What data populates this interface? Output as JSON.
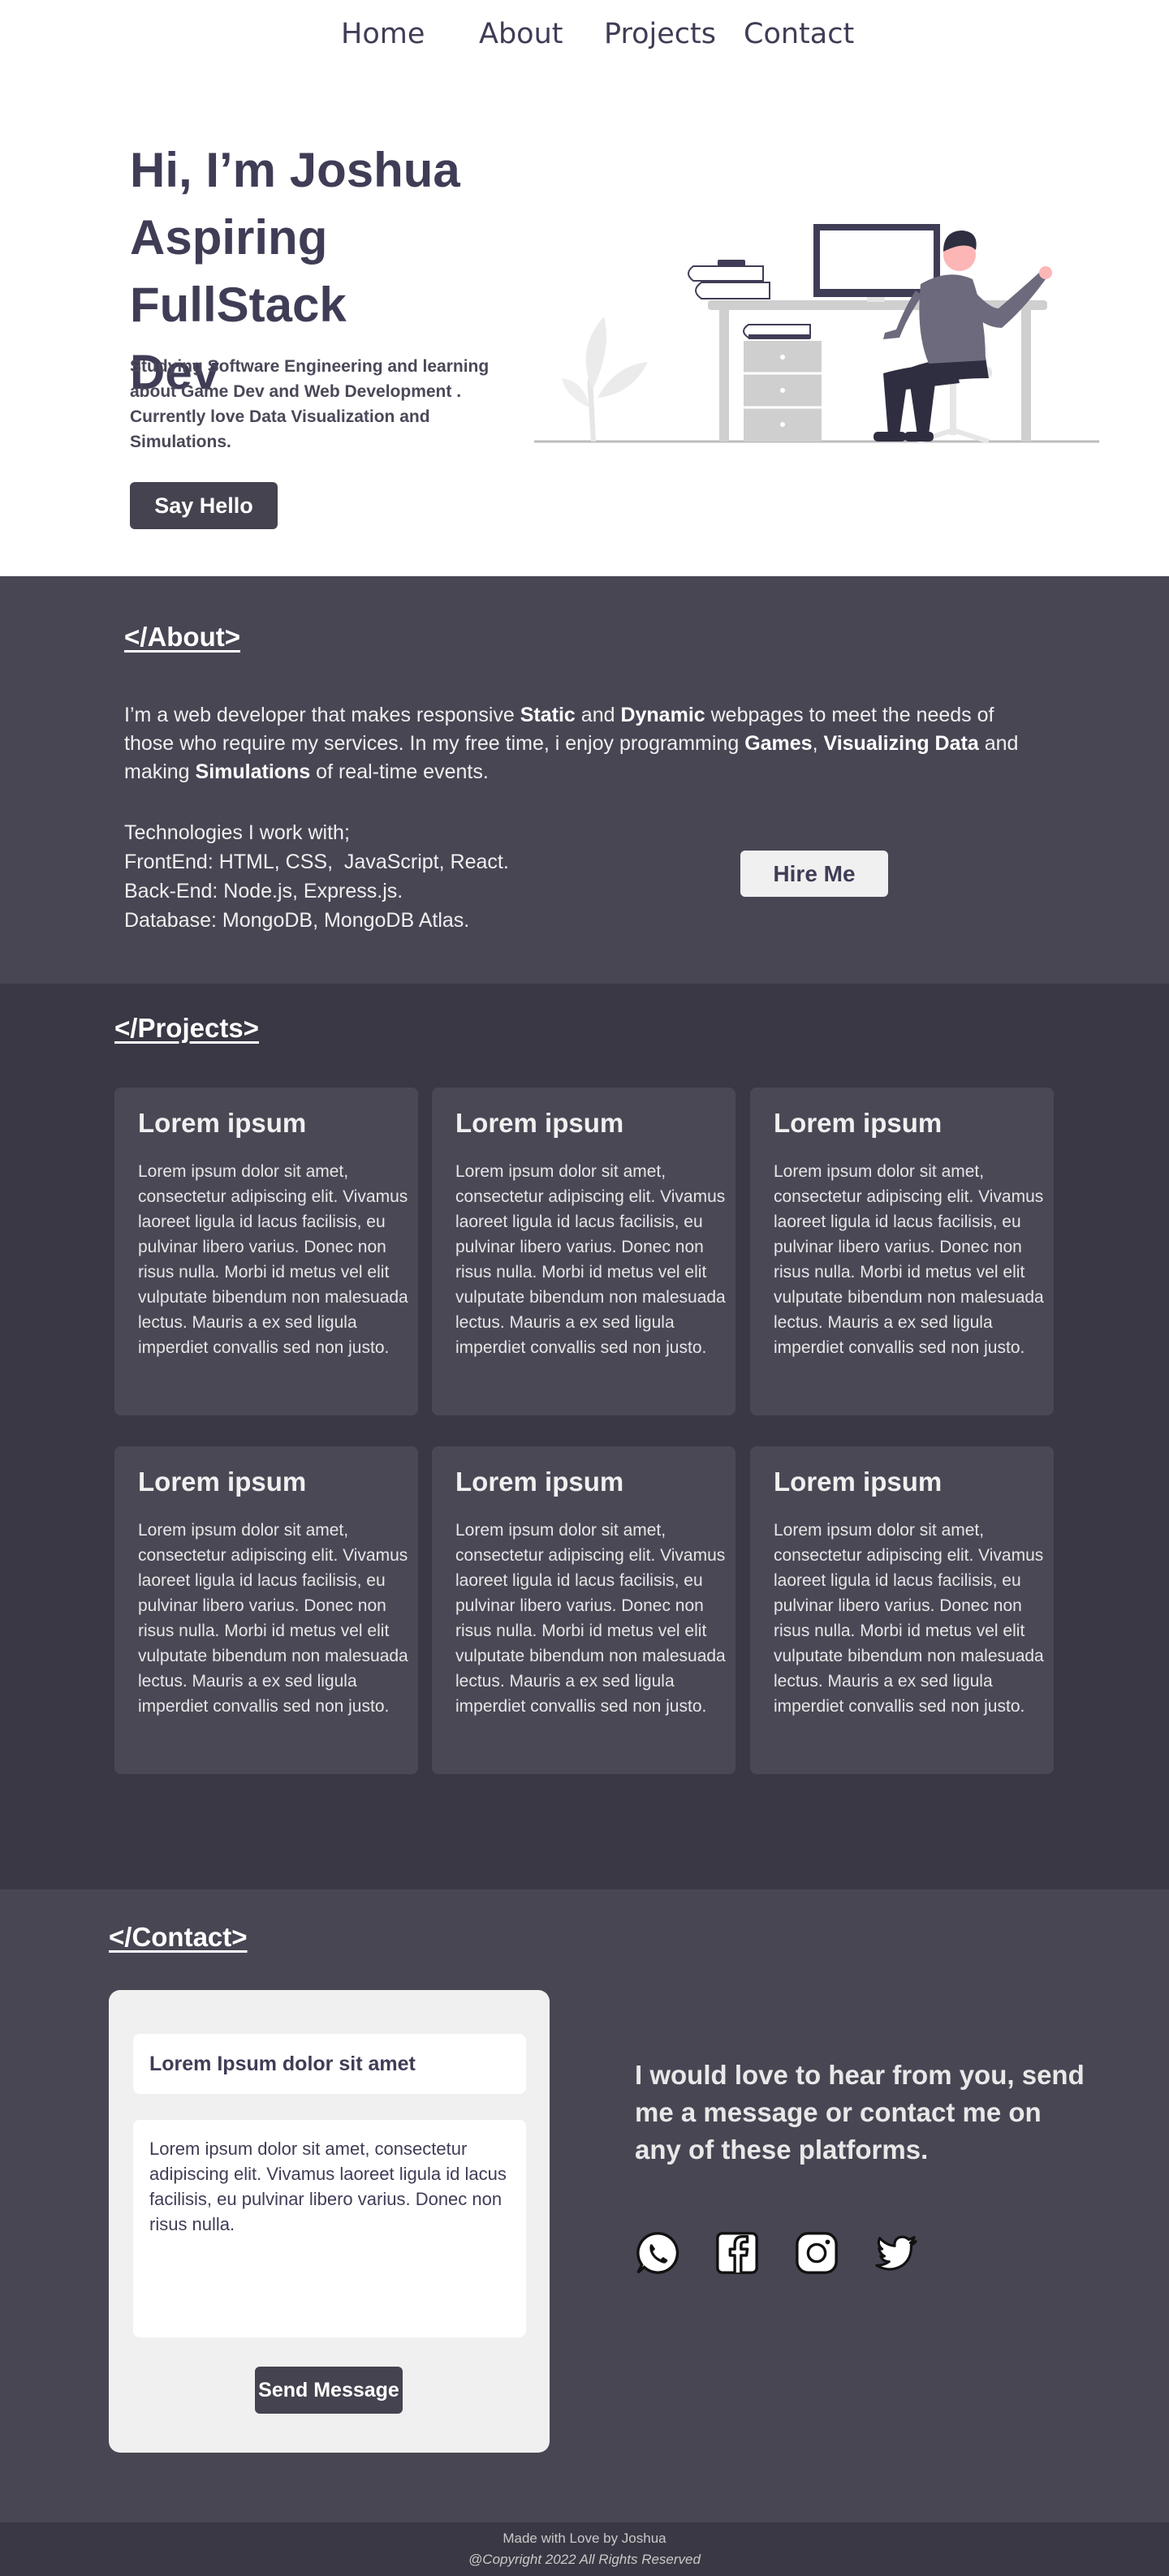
{
  "nav": {
    "items": [
      "Home",
      "About",
      "Projects",
      "Contact"
    ]
  },
  "hero": {
    "title_lines": [
      "Hi, I’m Joshua",
      "Aspiring FullStack",
      "Dev"
    ],
    "subtitle": "Studying Software Engineering and learning about Game Dev and Web Development . Currently love Data Visualization and Simulations.",
    "button": "Say Hello"
  },
  "about": {
    "title": "</About>",
    "para": {
      "t1": "I’m a web developer that makes responsive ",
      "b1": "Static",
      "t2": " and ",
      "b2": "Dynamic",
      "t3": " webpages to meet the needs of those who require my services. In my free time, i enjoy programming ",
      "b3": "Games",
      "t4": ", ",
      "b4": "Visualizing Data",
      "t5": " and making ",
      "b5": "Simulations",
      "t6": " of real-time events."
    },
    "tech": [
      "Technologies I work with;",
      "FrontEnd: HTML, CSS,  JavaScript, React.",
      "Back-End: Node.js, Express.js.",
      "Database: MongoDB, MongoDB Atlas."
    ],
    "hire_button": "Hire Me"
  },
  "projects": {
    "title": "</Projects>",
    "cards": [
      {
        "title": "Lorem ipsum",
        "body": "Lorem ipsum dolor sit amet, consectetur adipiscing elit. Vivamus laoreet ligula id lacus facilisis, eu pulvinar libero varius. Donec non risus nulla. Morbi id metus vel elit vulputate bibendum non malesuada lectus. Mauris a ex sed ligula imperdiet convallis sed non justo."
      },
      {
        "title": "Lorem ipsum",
        "body": "Lorem ipsum dolor sit amet, consectetur adipiscing elit. Vivamus laoreet ligula id lacus facilisis, eu pulvinar libero varius. Donec non risus nulla. Morbi id metus vel elit vulputate bibendum non malesuada lectus. Mauris a ex sed ligula imperdiet convallis sed non justo."
      },
      {
        "title": "Lorem ipsum",
        "body": "Lorem ipsum dolor sit amet, consectetur adipiscing elit. Vivamus laoreet ligula id lacus facilisis, eu pulvinar libero varius. Donec non risus nulla. Morbi id metus vel elit vulputate bibendum non malesuada lectus. Mauris a ex sed ligula imperdiet convallis sed non justo."
      },
      {
        "title": "Lorem ipsum",
        "body": "Lorem ipsum dolor sit amet, consectetur adipiscing elit. Vivamus laoreet ligula id lacus facilisis, eu pulvinar libero varius. Donec non risus nulla. Morbi id metus vel elit vulputate bibendum non malesuada lectus. Mauris a ex sed ligula imperdiet convallis sed non justo."
      },
      {
        "title": "Lorem ipsum",
        "body": "Lorem ipsum dolor sit amet, consectetur adipiscing elit. Vivamus laoreet ligula id lacus facilisis, eu pulvinar libero varius. Donec non risus nulla. Morbi id metus vel elit vulputate bibendum non malesuada lectus. Mauris a ex sed ligula imperdiet convallis sed non justo."
      },
      {
        "title": "Lorem ipsum",
        "body": "Lorem ipsum dolor sit amet, consectetur adipiscing elit. Vivamus laoreet ligula id lacus facilisis, eu pulvinar libero varius. Donec non risus nulla. Morbi id metus vel elit vulputate bibendum non malesuada lectus. Mauris a ex sed ligula imperdiet convallis sed non justo."
      }
    ]
  },
  "contact": {
    "title": "</Contact>",
    "subject_value": "Lorem Ipsum dolor sit amet",
    "message_value": "Lorem ipsum dolor sit amet, consectetur adipiscing elit. Vivamus laoreet ligula id lacus facilisis, eu pulvinar libero varius. Donec non risus nulla.",
    "send_button": "Send Message",
    "text": "I would love to hear from you, send me a message or contact me on any of these platforms.",
    "socials": [
      "whatsapp-icon",
      "facebook-icon",
      "instagram-icon",
      "twitter-icon"
    ]
  },
  "footer": {
    "line1": "Made with Love by Joshua",
    "line2": "@Copyright 2022 All Rights Reserved"
  },
  "colors": {
    "primary": "#3f3d56",
    "about_bg": "#484653",
    "projects_bg": "#3a3844",
    "card_bg": "#4a4855",
    "light": "#f0f0f0"
  }
}
